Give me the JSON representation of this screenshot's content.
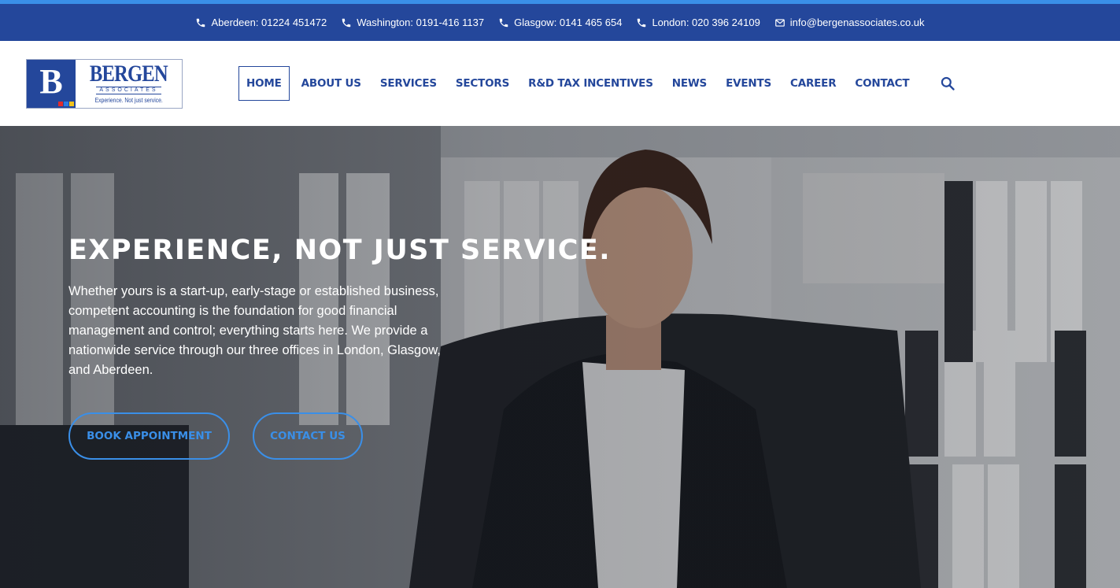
{
  "topbar": {
    "contacts": [
      {
        "icon": "phone-icon",
        "text": "Aberdeen: 01224 451472"
      },
      {
        "icon": "phone-icon",
        "text": "Washington: 0191-416 1137"
      },
      {
        "icon": "phone-icon",
        "text": "Glasgow: 0141 465 654"
      },
      {
        "icon": "phone-icon",
        "text": "London: 020 396 24109"
      },
      {
        "icon": "mail-icon",
        "text": "info@bergenassociates.co.uk"
      }
    ]
  },
  "logo": {
    "letter": "B",
    "name": "BERGEN",
    "sub": "ASSOCIATES",
    "tagline": "Experience. Not just service."
  },
  "nav": {
    "items": [
      "HOME",
      "ABOUT US",
      "SERVICES",
      "SECTORS",
      "R&D TAX INCENTIVES",
      "NEWS",
      "EVENTS",
      "CAREER",
      "CONTACT"
    ],
    "active": "HOME",
    "search_icon": "search-icon"
  },
  "hero": {
    "title": "EXPERIENCE, NOT JUST SERVICE.",
    "text": "Whether yours is a start-up, early-stage or established business, competent accounting is the foundation for good financial management and control; everything starts here. We provide a nationwide service through our three offices in London, Glasgow, and Aberdeen.",
    "book_label": "BOOK APPOINTMENT",
    "contact_label": "CONTACT US"
  },
  "colors": {
    "brand_blue": "#24479b",
    "accent_blue": "#3a8fe8",
    "logo_squares": [
      "#e32b2b",
      "#2b7be3",
      "#f2c21b"
    ]
  }
}
